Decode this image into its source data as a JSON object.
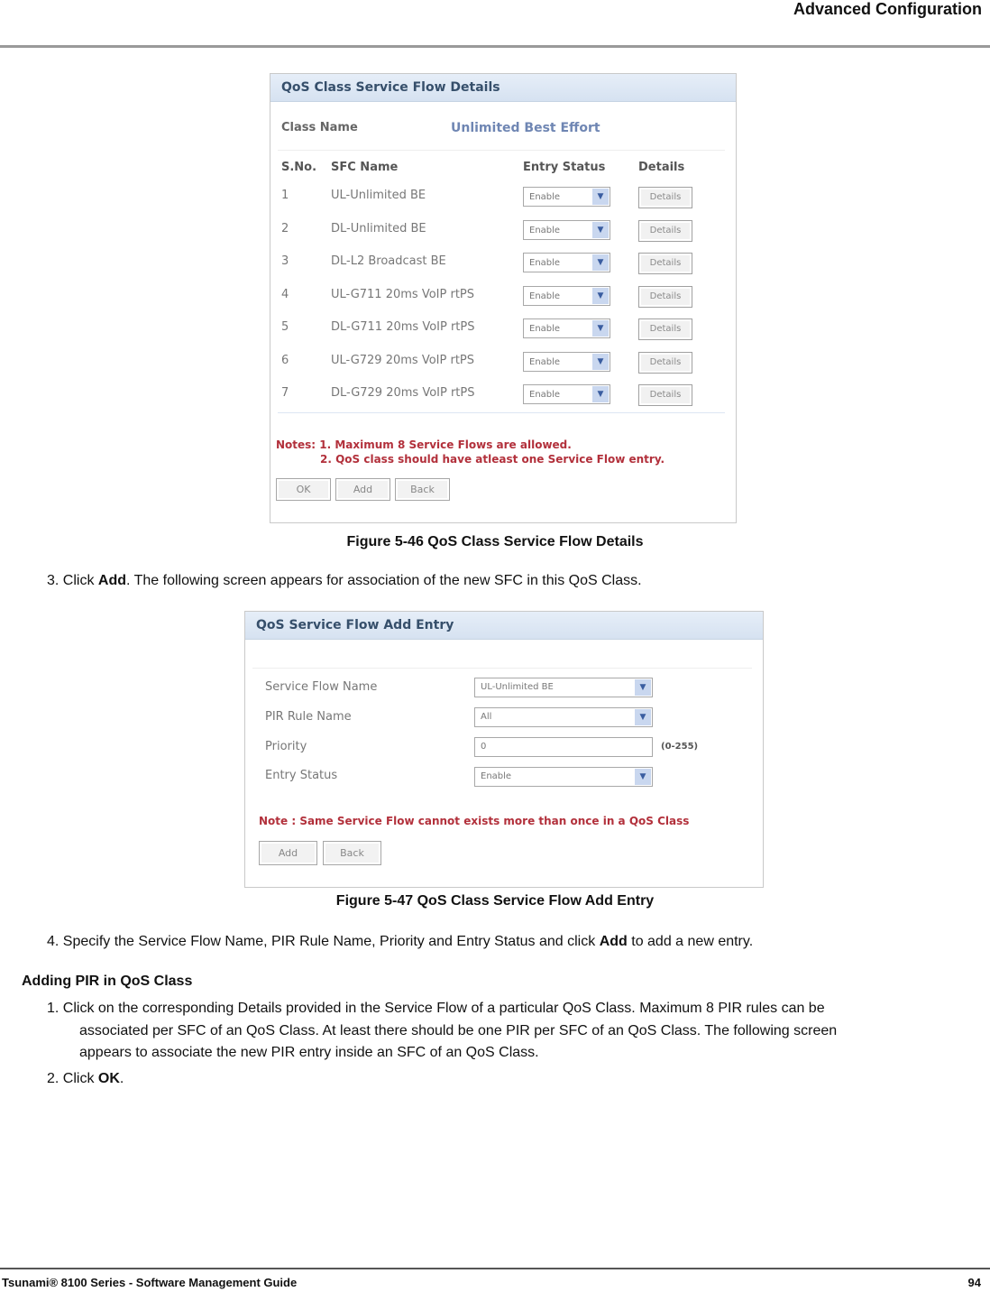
{
  "page": {
    "header_title": "Advanced Configuration",
    "footer_left": "Tsunami® 8100 Series - Software Management Guide",
    "footer_page": "94"
  },
  "figure1": {
    "panel_title": "QoS Class Service Flow Details",
    "class_name_label": "Class Name",
    "class_name_value": "Unlimited Best Effort",
    "columns": [
      "S.No.",
      "SFC Name",
      "Entry Status",
      "Details"
    ],
    "rows": [
      {
        "sno": "1",
        "sfc": "UL-Unlimited BE",
        "status": "Enable",
        "details": "Details"
      },
      {
        "sno": "2",
        "sfc": "DL-Unlimited BE",
        "status": "Enable",
        "details": "Details"
      },
      {
        "sno": "3",
        "sfc": "DL-L2 Broadcast BE",
        "status": "Enable",
        "details": "Details"
      },
      {
        "sno": "4",
        "sfc": "UL-G711 20ms VoIP rtPS",
        "status": "Enable",
        "details": "Details"
      },
      {
        "sno": "5",
        "sfc": "DL-G711 20ms VoIP rtPS",
        "status": "Enable",
        "details": "Details"
      },
      {
        "sno": "6",
        "sfc": "UL-G729 20ms VoIP rtPS",
        "status": "Enable",
        "details": "Details"
      },
      {
        "sno": "7",
        "sfc": "DL-G729 20ms VoIP rtPS",
        "status": "Enable",
        "details": "Details"
      }
    ],
    "notes_line1": "Notes:  1. Maximum 8 Service Flows are allowed.",
    "notes_line2": "2. QoS class should have atleast one Service Flow entry.",
    "buttons": {
      "ok": "OK",
      "add": "Add",
      "back": "Back"
    },
    "caption": "Figure 5-46 QoS Class Service Flow Details"
  },
  "step3": {
    "prefix": "3.  Click ",
    "bold": "Add",
    "suffix": ". The following screen appears for association of the new SFC in this QoS Class."
  },
  "figure2": {
    "panel_title": "QoS Service Flow Add Entry",
    "fields": {
      "service_flow_name": {
        "label": "Service Flow Name",
        "value": "UL-Unlimited BE"
      },
      "pir_rule_name": {
        "label": "PIR Rule Name",
        "value": "All"
      },
      "priority": {
        "label": "Priority",
        "value": "0",
        "range": "(0-255)"
      },
      "entry_status": {
        "label": "Entry Status",
        "value": "Enable"
      }
    },
    "note": "Note : Same Service Flow cannot exists more than once in a QoS Class",
    "buttons": {
      "add": "Add",
      "back": "Back"
    },
    "caption": "Figure 5-47 QoS Class Service Flow Add Entry"
  },
  "step4": {
    "prefix": "4.  Specify the Service Flow Name, PIR Rule Name, Priority and Entry Status and click ",
    "bold": "Add",
    "suffix": " to add a new entry."
  },
  "section": {
    "heading": "Adding PIR in QoS Class",
    "item1_line1": "1.  Click on the corresponding Details provided in the Service Flow of a particular QoS Class. Maximum 8 PIR rules can be",
    "item1_line2": "associated per SFC of an QoS Class. At least there should be one PIR per SFC of an QoS Class. The following screen",
    "item1_line3": "appears to associate the new PIR entry inside an SFC of an QoS Class.",
    "item2_prefix": "2.  Click ",
    "item2_bold": "OK",
    "item2_suffix": "."
  },
  "icons": {
    "dropdown_arrow": "▼"
  }
}
